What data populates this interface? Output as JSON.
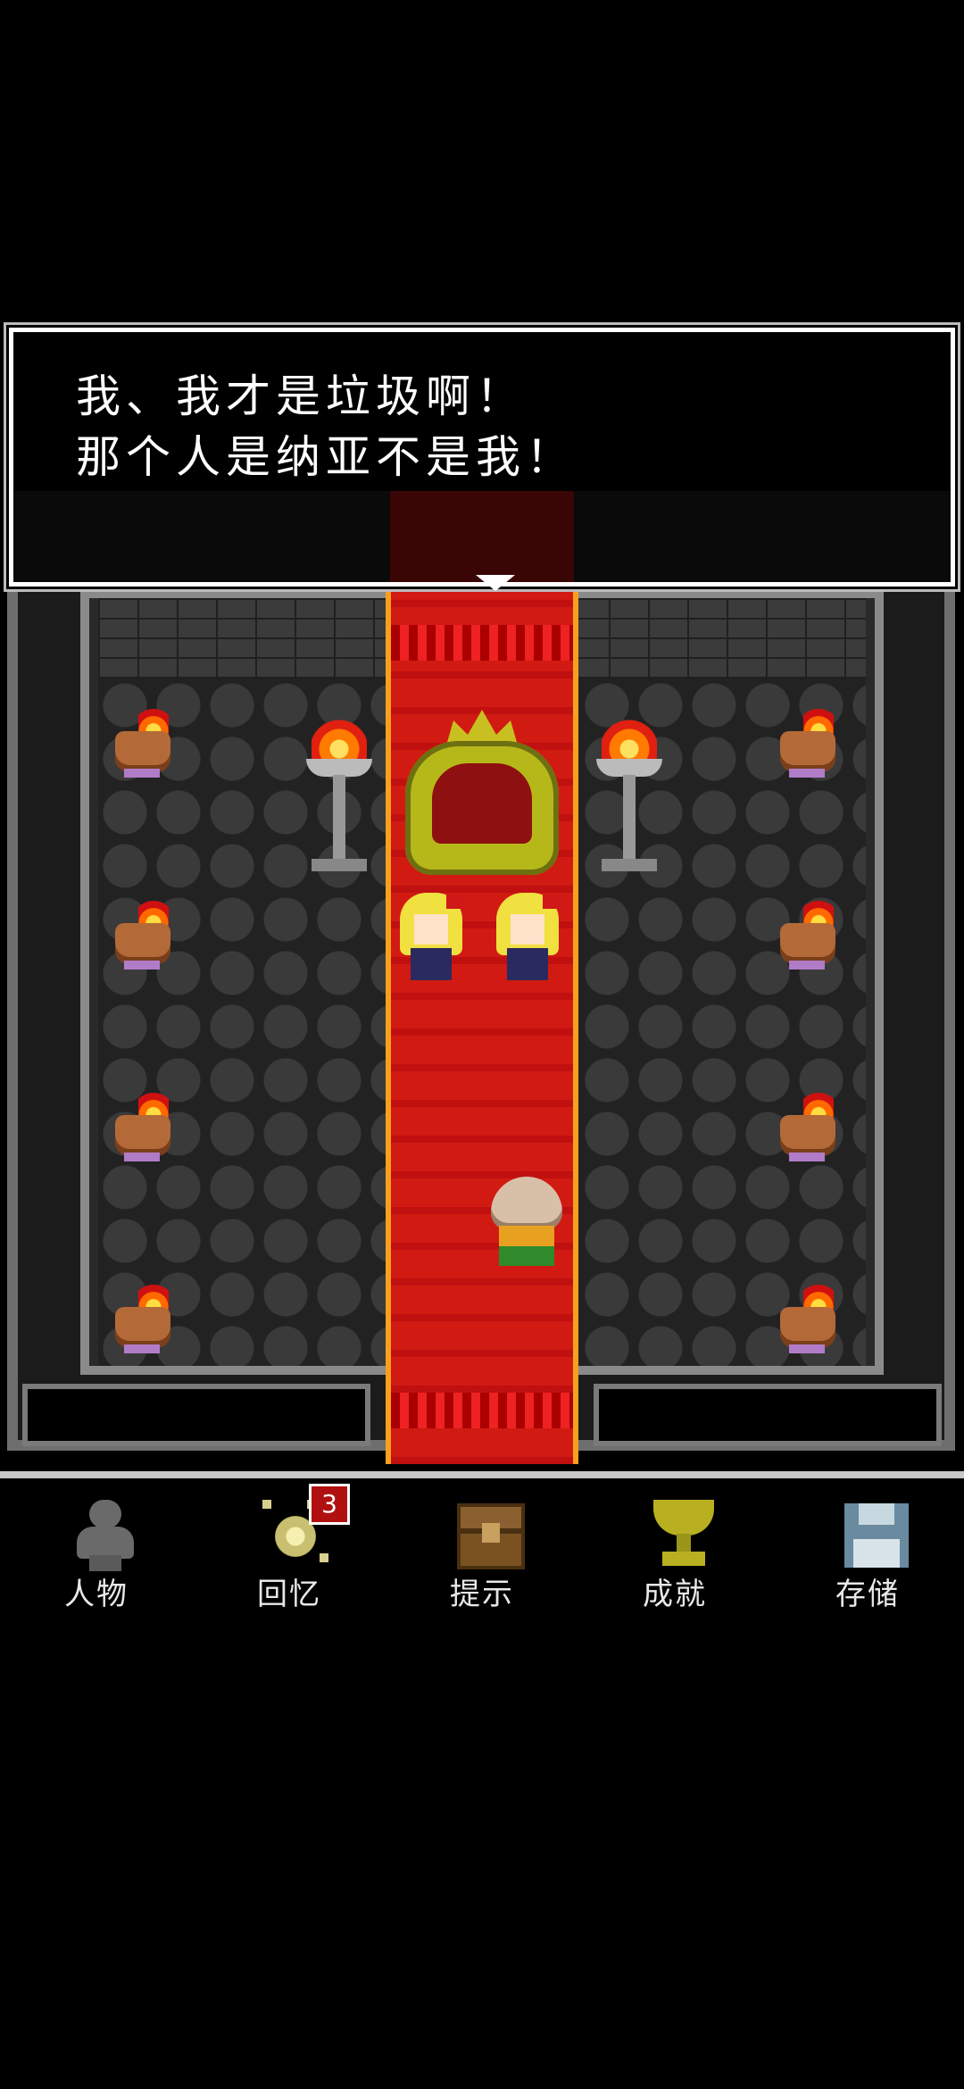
{
  "dialog": {
    "line1": "我、我才是垃圾啊！",
    "line2": "那个人是纳亚不是我！"
  },
  "menu": {
    "items": [
      {
        "label": "人物",
        "icon": "person-icon"
      },
      {
        "label": "回忆",
        "icon": "memory-orb-icon",
        "badge": "3"
      },
      {
        "label": "提示",
        "icon": "treasure-chest-icon"
      },
      {
        "label": "成就",
        "icon": "trophy-icon"
      },
      {
        "label": "存储",
        "icon": "save-disk-icon"
      }
    ]
  },
  "colors": {
    "carpet": "#d11a12",
    "carpet_trim": "#f6a020",
    "badge": "#b01010"
  }
}
